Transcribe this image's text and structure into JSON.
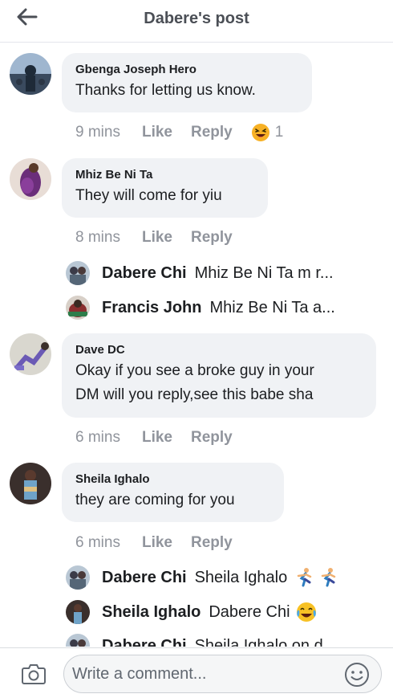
{
  "header": {
    "title": "Dabere's post"
  },
  "comments": [
    {
      "name": "Gbenga Joseph Hero",
      "text": "Thanks for letting us know.",
      "time": "9 mins",
      "like_label": "Like",
      "reply_label": "Reply",
      "reaction_icon": "laughing-emoji",
      "reaction_count": "1"
    },
    {
      "name": "Mhiz Be Ni Ta",
      "text": "They will come for yiu",
      "time": "8 mins",
      "like_label": "Like",
      "reply_label": "Reply",
      "replies": [
        {
          "name": "Dabere Chi",
          "text": "Mhiz Be Ni Ta m r..."
        },
        {
          "name": "Francis John",
          "text": "Mhiz Be Ni Ta a..."
        }
      ]
    },
    {
      "name": "Dave DC",
      "text_line1": "Okay if you see a broke guy in your",
      "text_line2": "DM will you reply,see this babe sha",
      "time": "6 mins",
      "like_label": "Like",
      "reply_label": "Reply"
    },
    {
      "name": "Sheila Ighalo",
      "text": "they are coming for you",
      "time": "6 mins",
      "like_label": "Like",
      "reply_label": "Reply",
      "replies": [
        {
          "name": "Dabere Chi",
          "text": "Sheila Ighalo",
          "emoji": "running-man-emoji"
        },
        {
          "name": "Sheila Ighalo",
          "text": "Dabere Chi",
          "emoji": "crying-laughing-emoji"
        },
        {
          "name": "Dabere Chi",
          "text": "Sheila Ighalo on d..."
        }
      ]
    }
  ],
  "footer": {
    "placeholder": "Write a comment..."
  }
}
